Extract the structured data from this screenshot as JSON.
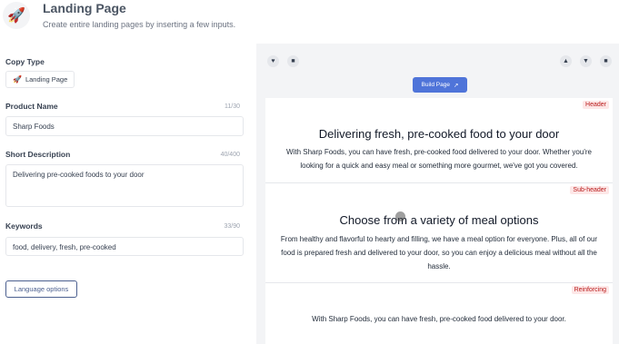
{
  "header": {
    "title": "Landing Page",
    "subtitle": "Create entire landing pages by inserting a few inputs.",
    "logo_icon": "rocket-icon"
  },
  "form": {
    "copy_type_label": "Copy Type",
    "copy_type_chip": "Landing Page",
    "product_name_label": "Product Name",
    "product_name_counter": "11/30",
    "product_name_value": "Sharp Foods",
    "short_desc_label": "Short Description",
    "short_desc_counter": "40/400",
    "short_desc_value": "Delivering pre-cooked foods to your door",
    "keywords_label": "Keywords",
    "keywords_counter": "33/90",
    "keywords_value": "food, delivery, fresh, pre-cooked",
    "language_button": "Language options"
  },
  "toolbar": {
    "build_page": "Build Page",
    "icons": [
      "heart-icon",
      "trash-icon",
      "thumbs-up-icon",
      "thumbs-down-icon",
      "trash-icon"
    ]
  },
  "preview": {
    "sections": [
      {
        "tag": "Header",
        "title": "Delivering fresh, pre-cooked food to your door",
        "body": "With Sharp Foods, you can have fresh, pre-cooked food delivered to your door. Whether you're looking for a quick and easy meal or something more gourmet, we've got you covered."
      },
      {
        "tag": "Sub-header",
        "title": "Choose from a variety of meal options",
        "body": "From healthy and flavorful to hearty and filling, we have a meal option for everyone. Plus, all of our food is prepared fresh and delivered to your door, so you can enjoy a delicious meal without all the hassle."
      },
      {
        "tag": "Reinforcing",
        "body": "With Sharp Foods, you can have fresh, pre-cooked food delivered to your door."
      }
    ]
  },
  "colors": {
    "accent": "#4f74d9",
    "tag_bg": "#fde7e7",
    "tag_text": "#b91c1c",
    "panel_bg": "#f3f4f6"
  }
}
